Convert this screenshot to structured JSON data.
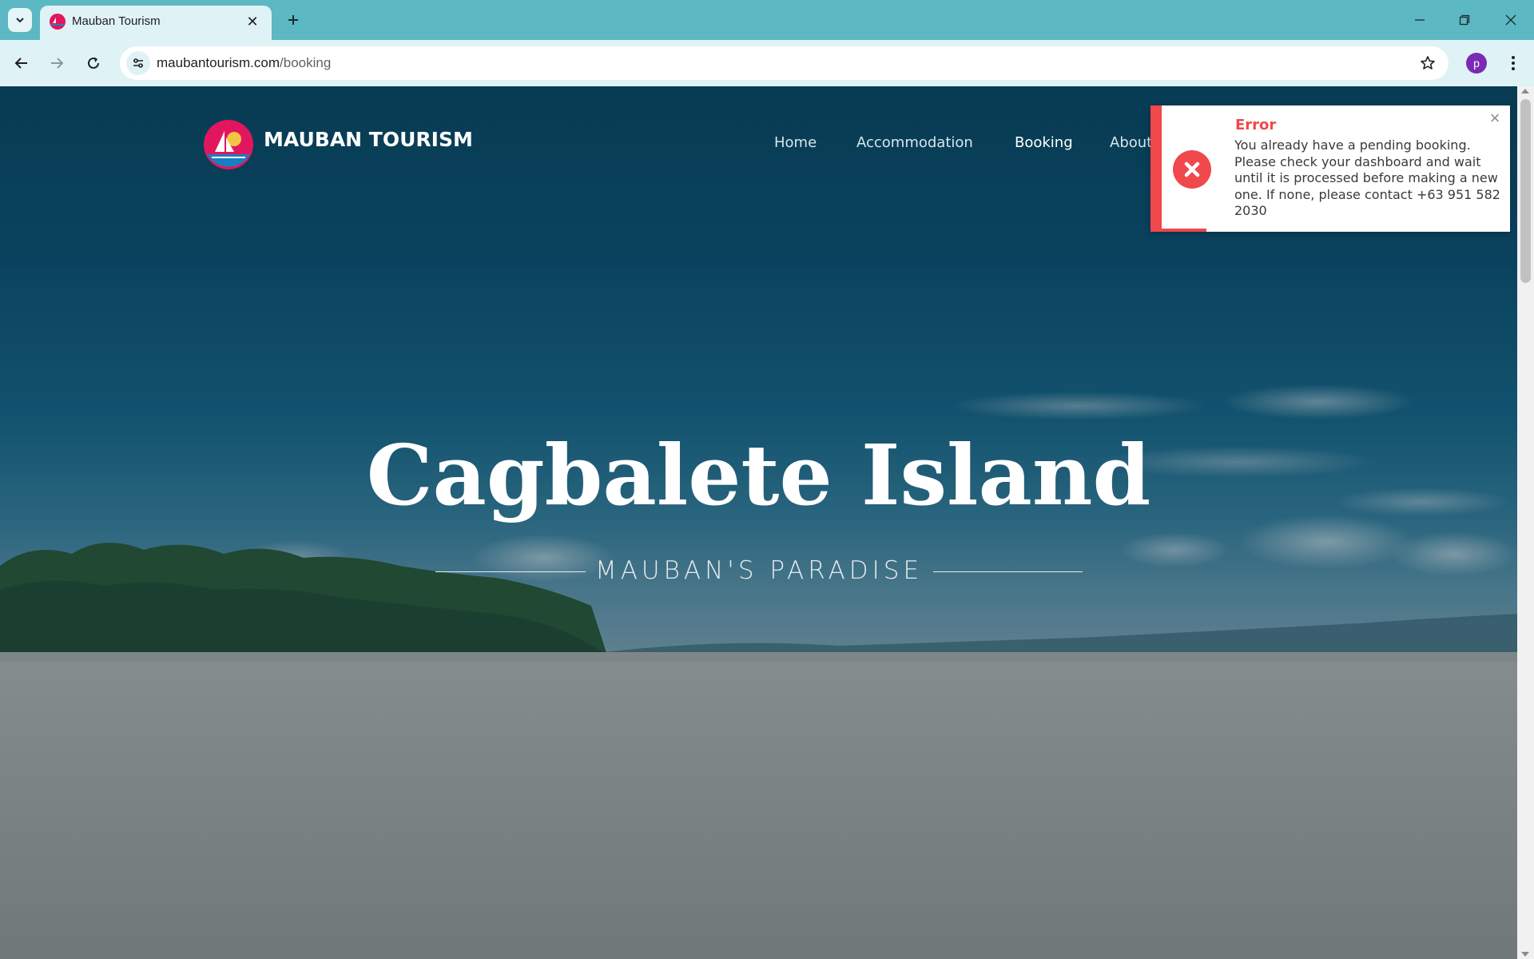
{
  "browser": {
    "tab": {
      "title": "Mauban Tourism",
      "favicon": "mauban-logo-icon"
    },
    "omnibox": {
      "domain": "maubantourism.com",
      "path": "/booking"
    },
    "profile_initial": "p"
  },
  "site": {
    "brand": "MAUBAN TOURISM",
    "nav": [
      {
        "label": "Home",
        "active": false
      },
      {
        "label": "Accommodation",
        "active": false
      },
      {
        "label": "Booking",
        "active": true
      },
      {
        "label": "About",
        "active": false
      }
    ],
    "hero": {
      "title": "Cagbalete Island",
      "tagline": "MAUBAN'S PARADISE"
    }
  },
  "toast": {
    "type": "error",
    "title": "Error",
    "message": "You already have a pending booking. Please check your dashboard and wait until it is processed before making a new one. If none, please contact +63 951 582 2030",
    "close_label": "×",
    "accent_color": "#f0484c"
  },
  "colors": {
    "browser_frame": "#5cb8c2",
    "toolbar": "#dff2f5",
    "error": "#f0484c",
    "avatar": "#7b2ab5"
  }
}
